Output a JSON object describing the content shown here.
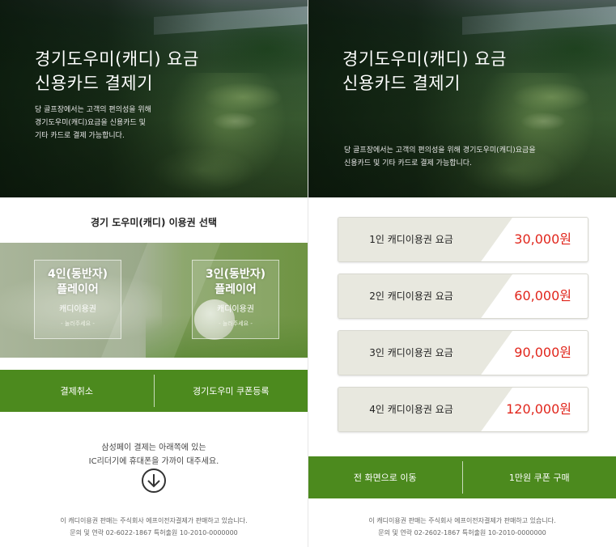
{
  "left": {
    "hero": {
      "title_line1": "경기도우미(캐디) 요금",
      "title_line2": "신용카드 결제기",
      "desc_line1": "당 골프장에서는 고객의 편의성을 위해",
      "desc_line2": "경기도우미(캐디)요금을 신용카드 및",
      "desc_line3": "기타 카드로 결제 가능합니다."
    },
    "select_title": "경기 도우미(캐디) 이용권 선택",
    "cards": [
      {
        "title_line1": "4인(동반자)",
        "title_line2": "플레이어",
        "sub": "캐디이용권",
        "hint": "- 눌러주세요 -"
      },
      {
        "title_line1": "3인(동반자)",
        "title_line2": "플레이어",
        "sub": "캐디이용권",
        "hint": "- 눌러주세요 -"
      }
    ],
    "actions": {
      "cancel": "결제취소",
      "coupon_register": "경기도우미 쿠폰등록"
    },
    "notice_line1": "삼성페이 결제는 아래쪽에 있는",
    "notice_line2": "IC리더기에 휴대폰을 가까이 대주세요.",
    "footer_line1": "이 캐디이용권 판매는 주식회사 에프이전자결제가 판매하고 있습니다.",
    "footer_line2": "문의 및 연락 02-6022-1867    특허출원 10-2010-0000000"
  },
  "right": {
    "hero": {
      "title_line1": "경기도우미(캐디) 요금",
      "title_line2": "신용카드 결제기",
      "desc_line1": "당 골프장에서는 고객의 편의성을 위해 경기도우미(캐디)요금을",
      "desc_line2": "신용카드 및 기타 카드로 결제 가능합니다."
    },
    "prices": [
      {
        "label": "1인 캐디이용권 요금",
        "amount": "30,000원"
      },
      {
        "label": "2인 캐디이용권 요금",
        "amount": "60,000원"
      },
      {
        "label": "3인 캐디이용권 요금",
        "amount": "90,000원"
      },
      {
        "label": "4인 캐디이용권 요금",
        "amount": "120,000원"
      }
    ],
    "actions": {
      "home": "전 화면으로 이동",
      "buy_coupon": "1만원 쿠폰 구매"
    },
    "footer_line1": "이 캐디이용권 판매는 주식회사 에프이전자결제가 판매하고 있습니다.",
    "footer_line2": "문의 및 연락 02-2602-1867    특허출원 10-2010-0000000"
  },
  "colors": {
    "accent_green": "#4c8a1e",
    "price_red": "#e1261c",
    "label_bg": "#e8e8df"
  },
  "icons": {
    "download": "arrow-down-circle-icon"
  }
}
